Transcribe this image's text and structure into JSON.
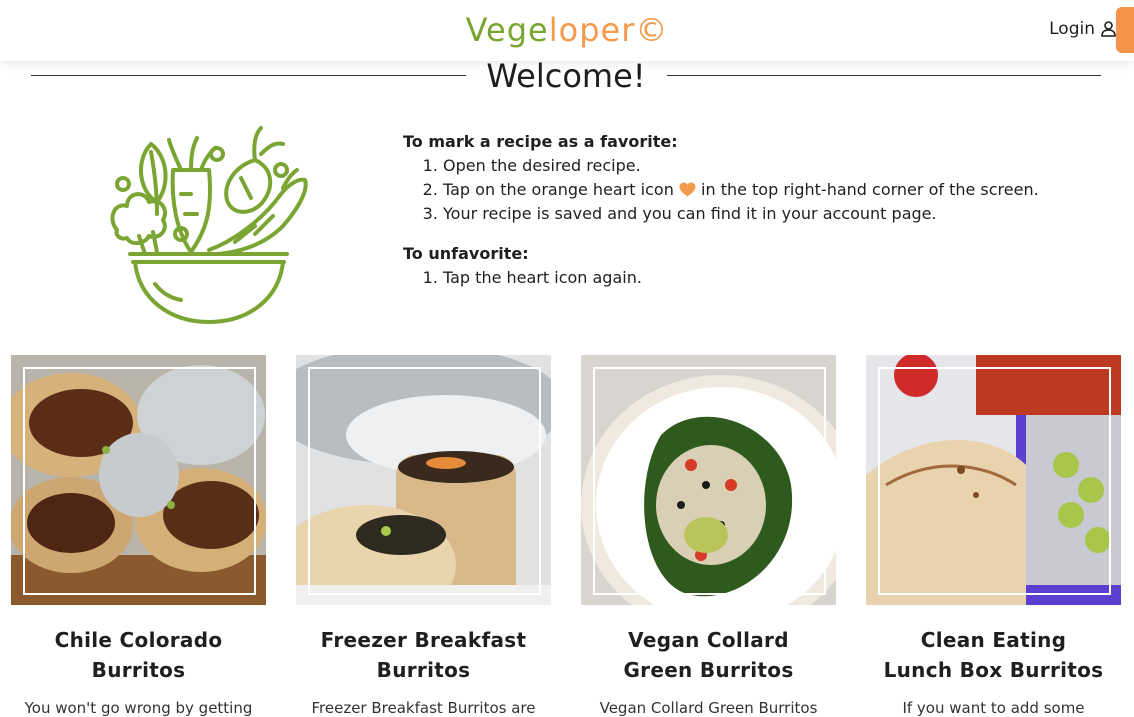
{
  "header": {
    "logo_main_1": "Vege",
    "logo_main_2": "loper",
    "logo_mark": "©",
    "login_label": "Login",
    "login_icon": "user-icon"
  },
  "welcome": {
    "title": "Welcome!"
  },
  "instructions": {
    "favorite_heading": "To mark a recipe as a favorite:",
    "favorite_steps": [
      "Open the desired recipe.",
      "Tap on the orange heart icon",
      "in the top right-hand corner of the screen.",
      "Your recipe is saved and you can find it in your account page."
    ],
    "unfavorite_heading": "To unfavorite:",
    "unfavorite_steps": [
      "Tap the heart icon again."
    ]
  },
  "recipes": [
    {
      "title_line1": "Chile Colorado",
      "title_line2": "Burritos",
      "desc": "You won't go wrong by getting"
    },
    {
      "title_line1": "Freezer Breakfast",
      "title_line2": "Burritos",
      "desc": "Freezer Breakfast Burritos are"
    },
    {
      "title_line1": "Vegan Collard",
      "title_line2": "Green Burritos",
      "desc": "Vegan Collard Green Burritos"
    },
    {
      "title_line1": "Clean Eating",
      "title_line2": "Lunch Box Burritos",
      "desc": "If you want to add some"
    }
  ],
  "colors": {
    "brand_green": "#7aa532",
    "brand_orange": "#f39a4c"
  }
}
